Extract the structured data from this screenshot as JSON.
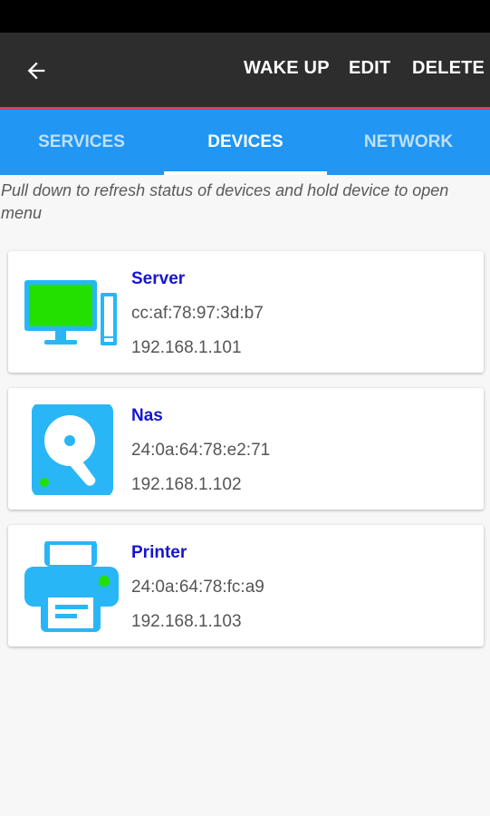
{
  "app_bar": {
    "back_icon": "arrow-left-icon",
    "actions": [
      "WAKE UP",
      "EDIT",
      "DELETE"
    ]
  },
  "tabs": [
    {
      "label": "SERVICES",
      "active": false
    },
    {
      "label": "DEVICES",
      "active": true
    },
    {
      "label": "NETWORK",
      "active": false
    }
  ],
  "hint": "Pull down to refresh status of devices and hold device to open menu",
  "devices": [
    {
      "name": "Server",
      "mac": "cc:af:78:97:3d:b7",
      "ip": "192.168.1.101",
      "icon": "desktop-computer-icon"
    },
    {
      "name": "Nas",
      "mac": "24:0a:64:78:e2:71",
      "ip": "192.168.1.102",
      "icon": "hard-drive-icon"
    },
    {
      "name": "Printer",
      "mac": "24:0a:64:78:fc:a9",
      "ip": "192.168.1.103",
      "icon": "printer-icon"
    }
  ],
  "colors": {
    "app_bar": "#2d2d2d",
    "accent": "#e8336d",
    "tab_bar": "#2196f3",
    "device_icon": "#29b6f6",
    "status_online": "#22e000",
    "device_name": "#1515d2"
  }
}
